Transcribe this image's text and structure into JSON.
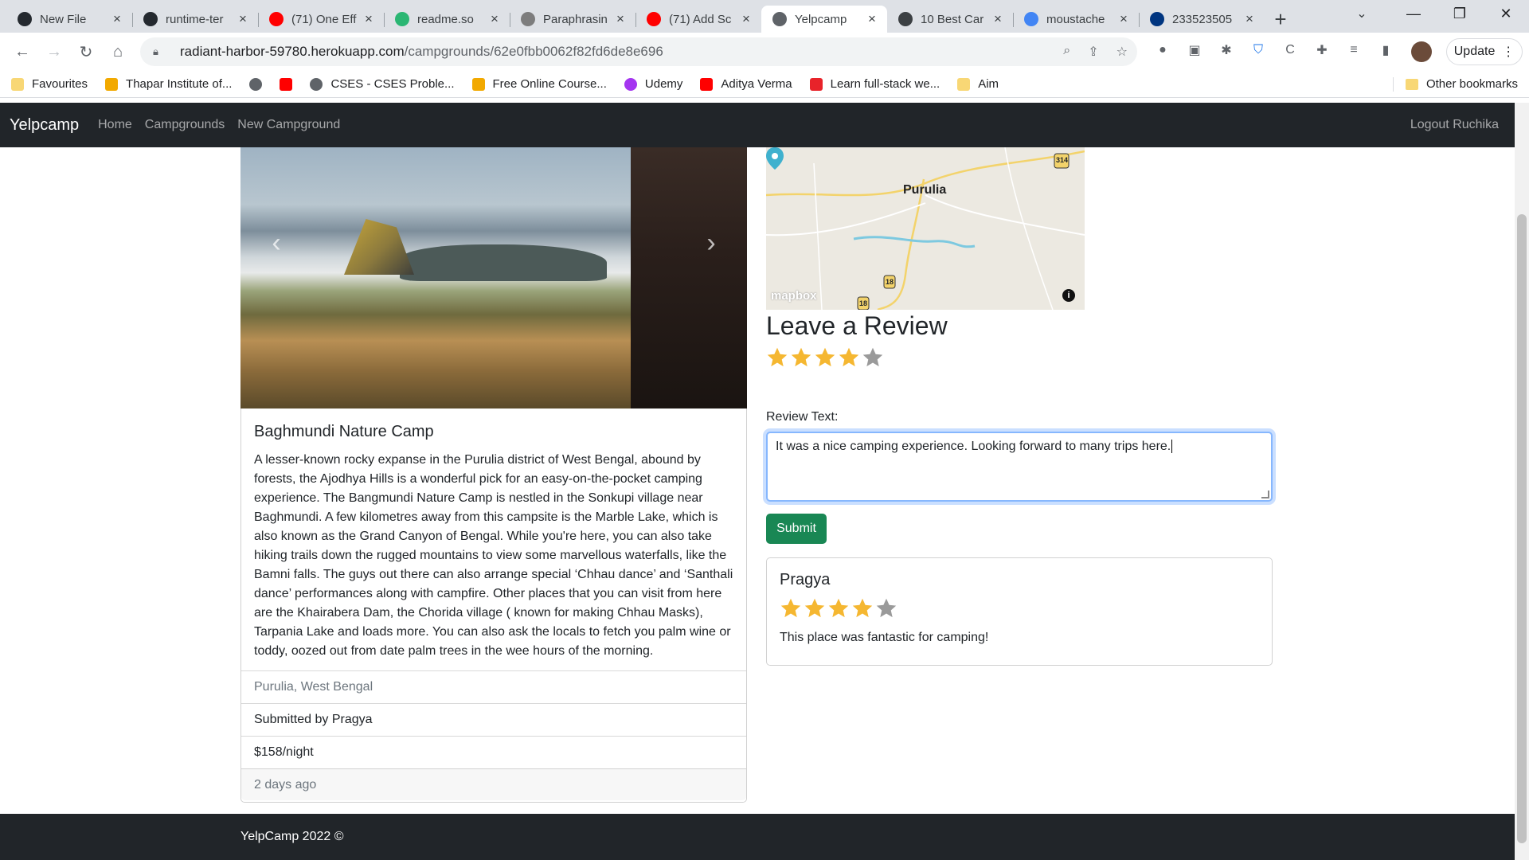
{
  "browser": {
    "tabs": [
      {
        "title": "New File",
        "favicon": "github-icon",
        "color": "#24292f"
      },
      {
        "title": "runtime-ter",
        "favicon": "github-icon",
        "color": "#24292f"
      },
      {
        "title": "(71) One Eff",
        "favicon": "youtube-icon",
        "color": "#ff0000"
      },
      {
        "title": "readme.so",
        "favicon": "readme-icon",
        "color": "#2bb673"
      },
      {
        "title": "Paraphrasin",
        "favicon": "quill-icon",
        "color": "#7d7d7d"
      },
      {
        "title": "(71) Add Sc",
        "favicon": "youtube-icon",
        "color": "#ff0000"
      },
      {
        "title": "Yelpcamp",
        "favicon": "globe-icon",
        "color": "#5f6368",
        "active": true
      },
      {
        "title": "10 Best Car",
        "favicon": "tent-icon",
        "color": "#3c4043"
      },
      {
        "title": "moustache",
        "favicon": "google-icon",
        "color": "#4285f4"
      },
      {
        "title": "233523505",
        "favicon": "booking-icon",
        "color": "#003580"
      }
    ],
    "url_host": "radiant-harbor-59780.herokuapp.com",
    "url_path": "/campgrounds/62e0fbb0062f82fd6de8e696",
    "update_label": "Update",
    "bookmarks": [
      {
        "label": "Favourites",
        "icon": "folder-icon"
      },
      {
        "label": "Thapar Institute of...",
        "icon": "thapar-icon"
      },
      {
        "label": "",
        "icon": "globe-icon"
      },
      {
        "label": "",
        "icon": "youtube-icon"
      },
      {
        "label": "CSES - CSES Proble...",
        "icon": "globe-icon"
      },
      {
        "label": "Free Online Course...",
        "icon": "course-icon"
      },
      {
        "label": "Udemy",
        "icon": "udemy-icon"
      },
      {
        "label": "Aditya Verma",
        "icon": "youtube-icon"
      },
      {
        "label": "Learn full-stack we...",
        "icon": "codecademy-icon"
      },
      {
        "label": "Aim",
        "icon": "folder-icon"
      }
    ],
    "other_bookmarks": "Other bookmarks"
  },
  "app": {
    "brand": "Yelpcamp",
    "nav": {
      "home": "Home",
      "campgrounds": "Campgrounds",
      "new": "New Campground"
    },
    "logout": "Logout Ruchika"
  },
  "campground": {
    "title": "Baghmundi Nature Camp",
    "description": "A lesser-known rocky expanse in the Purulia district of West Bengal, abound by forests, the Ajodhya Hills is a wonderful pick for an easy-on-the-pocket camping experience. The Bangmundi Nature Camp is nestled in the Sonkupi village near Baghmundi. A few kilometres away from this campsite is the Marble Lake, which is also known as the Grand Canyon of Bengal. While you're here, you can also take hiking trails down the rugged mountains to view some marvellous waterfalls, like the Bamni falls. The guys out there can also arrange special ‘Chhau dance’ and ‘Santhali dance’ performances along with campfire. Other places that you can visit from here are the Khairabera Dam, the Chorida village ( known for making Chhau Masks), Tarpania Lake and loads more. You can also ask the locals to fetch you palm wine or toddy, oozed out from date palm trees in the wee hours of the morning.",
    "location": "Purulia, West Bengal",
    "submitted_by": "Submitted by Pragya",
    "price": "$158/night",
    "posted": "2 days ago"
  },
  "map": {
    "place_label": "Purulia",
    "road_shields": [
      "314",
      "18",
      "18"
    ],
    "attribution": "mapbox"
  },
  "review_form": {
    "heading": "Leave a Review",
    "rating": 4,
    "max_rating": 5,
    "label": "Review Text:",
    "text": "It was a nice camping experience. Looking forward to many trips here.",
    "submit": "Submit"
  },
  "reviews": [
    {
      "author": "Pragya",
      "rating": 4,
      "body": "This place was fantastic for camping!"
    }
  ],
  "footer": "YelpCamp 2022 ©",
  "colors": {
    "star_filled": "#f5b731",
    "star_empty": "#9a9a9a",
    "navbar": "#212529",
    "submit": "#198754"
  }
}
